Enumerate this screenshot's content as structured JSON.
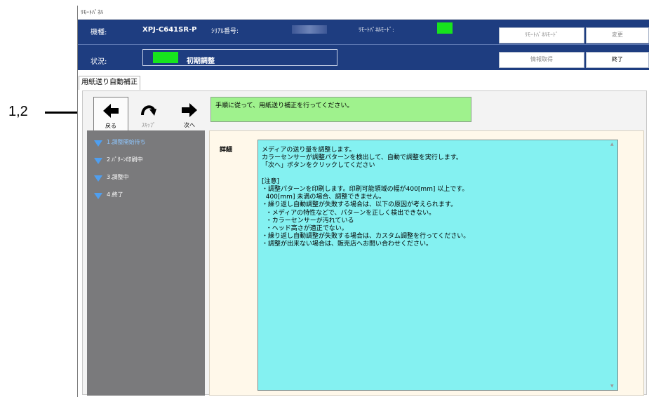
{
  "annotation": {
    "label": "1,2"
  },
  "window": {
    "title": "ﾘﾓｰﾄﾊﾟﾈﾙ"
  },
  "header": {
    "model_label": "機種:",
    "model_value": "XPJ-C641SR-P",
    "serial_label": "ｼﾘｱﾙ番号:",
    "remote_mode_label": "ﾘﾓｰﾄﾊﾟﾈﾙﾓｰﾄﾞ:",
    "status_label": "状況:",
    "status_value": "初期調整",
    "buttons": {
      "remote_mode": "ﾘﾓｰﾄﾊﾟﾈﾙﾓｰﾄﾞ",
      "change": "変更",
      "info": "情報取得",
      "exit": "終了"
    },
    "status_color": "#17e41d"
  },
  "tab": {
    "label": "用紙送り自動補正"
  },
  "toolbar": {
    "back": "戻る",
    "skip": "ｽｷｯﾌﾟ",
    "next": "次へ"
  },
  "message": "手順に従って、用紙送り補正を行ってください。",
  "steps": [
    {
      "label": "1.調整開始待ち",
      "active": true
    },
    {
      "label": "2.ﾊﾟﾀｰﾝ印刷中",
      "active": false
    },
    {
      "label": "3.調整中",
      "active": false
    },
    {
      "label": "4.終了",
      "active": false
    }
  ],
  "detail": {
    "label": "詳細",
    "lines": [
      "メディアの送り量を調整します。",
      "カラーセンサーが調整パターンを検出して、自動で調整を実行します。",
      "「次へ」ボタンをクリックしてください",
      "",
      "[注意]",
      "・調整パターンを印刷します。印刷可能領域の幅が400[mm] 以上です。",
      "  400[mm] 未満の場合、調整できません。",
      "・繰り返し自動調整が失敗する場合は、以下の原因が考えられます。",
      "  ・メディアの特性などで、パターンを正しく検出できない。",
      "  ・カラーセンサーが汚れている",
      "  ・ヘッド高さが適正でない。",
      "・繰り返し自動調整が失敗する場合は、カスタム調整を行ってください。",
      "・調整が出来ない場合は、販売店へお問い合わせください。"
    ]
  }
}
